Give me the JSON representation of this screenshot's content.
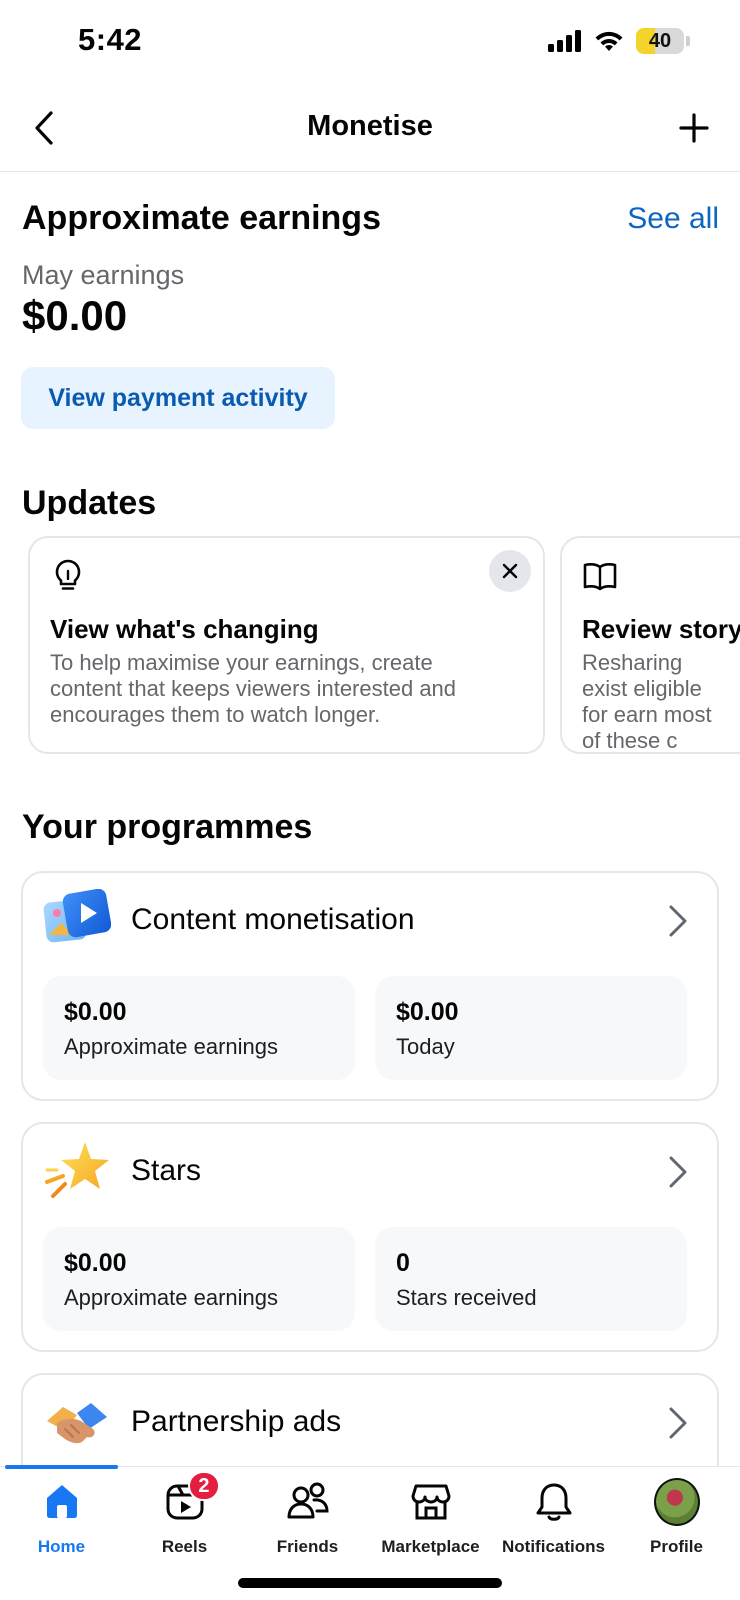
{
  "status_bar": {
    "time": "5:42",
    "battery_level": "40",
    "battery_fraction": 0.4,
    "battery_color": "#f4d32a"
  },
  "header": {
    "title": "Monetise",
    "back_icon": "chevron-left-icon",
    "add_icon": "plus-icon"
  },
  "earnings": {
    "title": "Approximate earnings",
    "see_all": "See all",
    "month_label": "May earnings",
    "amount": "$0.00",
    "payment_button": "View payment activity"
  },
  "updates": {
    "title": "Updates",
    "cards": [
      {
        "icon": "lightbulb-icon",
        "title": "View what's changing",
        "body": "To help maximise your earnings, create content that keeps viewers interested and encourages them to watch longer."
      },
      {
        "icon": "book-icon",
        "title": "Review story",
        "body": "Resharing exist eligible for earn most of these c"
      }
    ]
  },
  "programmes": {
    "title": "Your programmes",
    "items": [
      {
        "title": "Content monetisation",
        "icon": "video-photo-icon",
        "stats": [
          {
            "value": "$0.00",
            "label": "Approximate earnings"
          },
          {
            "value": "$0.00",
            "label": "Today"
          }
        ]
      },
      {
        "title": "Stars",
        "icon": "star-icon",
        "stats": [
          {
            "value": "$0.00",
            "label": "Approximate earnings"
          },
          {
            "value": "0",
            "label": "Stars received"
          }
        ]
      },
      {
        "title": "Partnership ads",
        "icon": "handshake-icon",
        "stats": []
      }
    ]
  },
  "tab_bar": {
    "active": "Home",
    "tabs": [
      {
        "label": "Home",
        "icon": "home-icon"
      },
      {
        "label": "Reels",
        "icon": "reels-icon",
        "badge": "2"
      },
      {
        "label": "Friends",
        "icon": "friends-icon"
      },
      {
        "label": "Marketplace",
        "icon": "marketplace-icon"
      },
      {
        "label": "Notifications",
        "icon": "bell-icon"
      },
      {
        "label": "Profile",
        "icon": "avatar"
      }
    ]
  },
  "colors": {
    "accent": "#1877f2",
    "link": "#0a66c2",
    "badge": "#e41e3f"
  }
}
